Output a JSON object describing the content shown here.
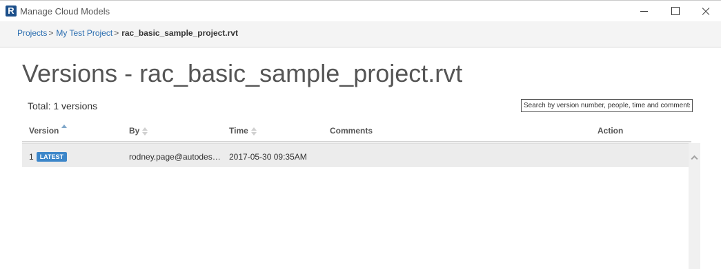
{
  "window": {
    "logo_letter": "R",
    "title": "Manage Cloud Models"
  },
  "breadcrumb": {
    "items": [
      "Projects",
      "My Test Project"
    ],
    "separator": ">",
    "current": "rac_basic_sample_project.rvt"
  },
  "page": {
    "title": "Versions - rac_basic_sample_project.rvt",
    "total": "Total: 1 versions",
    "search_placeholder": "Search by version number, people, time and comments"
  },
  "table": {
    "columns": [
      "Version",
      "By",
      "Time",
      "Comments",
      "Action"
    ],
    "sorted_column": "Version",
    "sort_direction": "ascending",
    "rows": [
      {
        "version": "1",
        "badge": "LATEST",
        "by": "rodney.page@autodes…",
        "time": "2017-05-30 09:35AM",
        "comments": "",
        "action": ""
      }
    ]
  },
  "icons": {
    "minimize": "minimize-icon",
    "maximize": "maximize-icon",
    "close": "close-icon",
    "scroll_up": "chevron-up-icon"
  },
  "colors": {
    "link": "#2a6db0",
    "badge": "#3c86c9",
    "logo": "#1c4f8a"
  }
}
